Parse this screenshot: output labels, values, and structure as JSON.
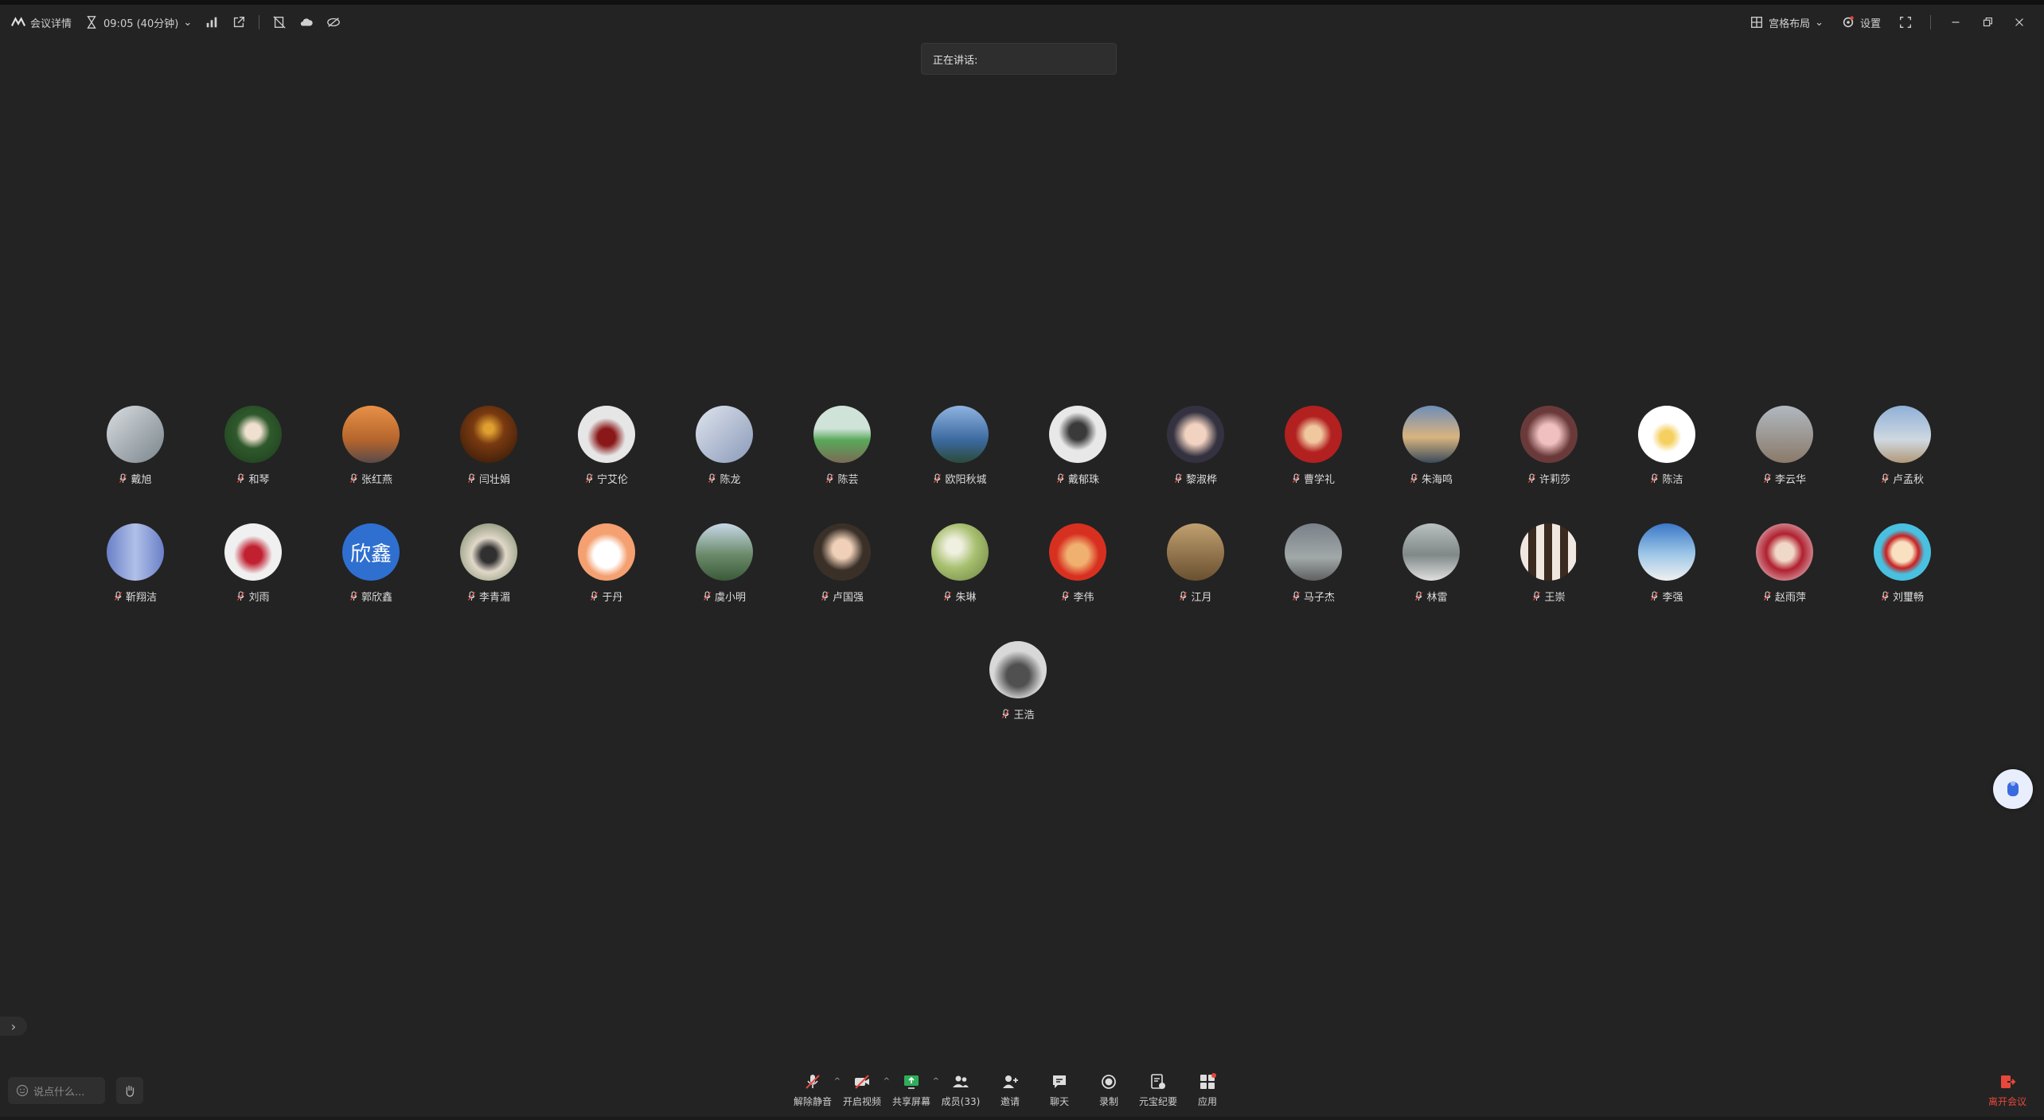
{
  "titlebar": {
    "details_label": "会议详情",
    "timer": "09:05 (40分钟)",
    "layout_label": "宫格布局",
    "settings_label": "设置"
  },
  "speaking_label": "正在讲话:",
  "participants": [
    {
      "name": "戴旭",
      "bg": "linear-gradient(135deg,#d9dde0,#7a858c)"
    },
    {
      "name": "和琴",
      "bg": "radial-gradient(circle at 50% 45%,#f0e0d0 18%,#2f5a2c 40%,#1d3b1b)"
    },
    {
      "name": "张红燕",
      "bg": "linear-gradient(180deg,#e89048,#b5652c 60%,#5a4a4a)"
    },
    {
      "name": "闫壮娟",
      "bg": "radial-gradient(circle at 50% 40%,#e0a030 10%,#7a3a10 35%,#2a1508)"
    },
    {
      "name": "宁艾伦",
      "bg": "radial-gradient(circle at 50% 55%,#8a1818 20%,#e6e6e6 45%)"
    },
    {
      "name": "陈龙",
      "bg": "linear-gradient(135deg,#dfe4ee,#8a9ab8)"
    },
    {
      "name": "陈芸",
      "bg": "linear-gradient(180deg,#cfe3d9 40%,#59a85a 60%,#7a6a55)"
    },
    {
      "name": "欧阳秋城",
      "bg": "linear-gradient(180deg,#8fb3e0,#3c6aa0 60%,#2b4a3a)"
    },
    {
      "name": "戴郁珠",
      "bg": "radial-gradient(circle at 50% 45%,#3a3a3a 20%,#e8e8e8 45%)"
    },
    {
      "name": "黎淑桦",
      "bg": "radial-gradient(circle at 50% 50%,#f2d2c0 25%,#343240 55%)"
    },
    {
      "name": "曹学礼",
      "bg": "radial-gradient(circle at 50% 50%,#f0c8a0 20%,#b22020 45%)"
    },
    {
      "name": "朱海鸣",
      "bg": "linear-gradient(180deg,#6e8db8,#d9b480 55%,#3a4a5a)"
    },
    {
      "name": "许莉莎",
      "bg": "radial-gradient(circle at 50% 50%,#f0c0c0 25%,#6a3a3a 55%)"
    },
    {
      "name": "陈洁",
      "bg": "radial-gradient(circle at 50% 55%,#f5d060 15%,#ffffff 35%)"
    },
    {
      "name": "李云华",
      "bg": "linear-gradient(180deg,#b0b8c0,#8a7a6a)"
    },
    {
      "name": "卢孟秋",
      "bg": "linear-gradient(180deg,#8fb0d8,#cfd8e0 60%,#b09878)"
    },
    {
      "name": "靳翔洁",
      "bg": "linear-gradient(90deg,#6a80c8,#b0c0e8,#6a80c8)"
    },
    {
      "name": "刘雨",
      "bg": "radial-gradient(circle at 50% 55%,#c02030 20%,#f0f0f0 45%)"
    },
    {
      "name": "郭欣鑫",
      "bg": "#2f6fd0",
      "text": "欣鑫"
    },
    {
      "name": "李青湄",
      "bg": "radial-gradient(circle at 50% 55%,#303030 18%,#e0d8c8 40%,#6a7a5a)"
    },
    {
      "name": "于丹",
      "bg": "radial-gradient(circle at 50% 55%,#ffffff 30%,#f4a070 50%)"
    },
    {
      "name": "虞小明",
      "bg": "linear-gradient(180deg,#c8d8e8,#6a8a6a 55%,#3a5a3a)"
    },
    {
      "name": "卢国强",
      "bg": "radial-gradient(circle at 50% 45%,#f0d0b8 22%,#3a3028 50%)"
    },
    {
      "name": "朱琳",
      "bg": "radial-gradient(circle at 40% 40%,#f0f0e0 15%,#a8c070 45%,#6a8040)"
    },
    {
      "name": "李伟",
      "bg": "radial-gradient(circle at 50% 55%,#f0b070 25%,#d83020 50%)"
    },
    {
      "name": "江月",
      "bg": "linear-gradient(180deg,#c0a070,#6a5030)"
    },
    {
      "name": "马子杰",
      "bg": "linear-gradient(180deg,#7a8088,#a0a8a8 60%,#606060)"
    },
    {
      "name": "林雷",
      "bg": "linear-gradient(180deg,#b8c0c0,#808888 55%,#e0e0e0)"
    },
    {
      "name": "王崇",
      "bg": "repeating-linear-gradient(90deg,#f0e8e0 0 10px,#3a2a20 10px 20px)"
    },
    {
      "name": "李强",
      "bg": "linear-gradient(180deg,#3a78c8,#a0c8e8 55%,#f0f0f0)"
    },
    {
      "name": "赵雨萍",
      "bg": "radial-gradient(circle at 50% 50%,#f0d8c8 22%,#b02030 45%,#f0e8e8)"
    },
    {
      "name": "刘璽畅",
      "bg": "radial-gradient(circle at 50% 50%,#f8e0c0 25%,#c82020 40%,#4ac0e0 55%)"
    },
    {
      "name": "王浩",
      "bg": "radial-gradient(circle at 50% 60%,#505050 25%,#d8d8d8 55%)"
    }
  ],
  "side_toggle": "›",
  "bottom": {
    "chat_placeholder": "说点什么...",
    "tools": [
      {
        "label": "解除静音",
        "icon": "mic-off-icon",
        "caret": true
      },
      {
        "label": "开启视频",
        "icon": "video-off-icon",
        "caret": true
      },
      {
        "label": "共享屏幕",
        "icon": "share-screen-icon",
        "caret": true
      },
      {
        "label": "成员(33)",
        "icon": "members-icon",
        "caret": false
      },
      {
        "label": "邀请",
        "icon": "invite-icon",
        "caret": false
      },
      {
        "label": "聊天",
        "icon": "chat-icon",
        "caret": false
      },
      {
        "label": "录制",
        "icon": "record-icon",
        "caret": false
      },
      {
        "label": "元宝纪要",
        "icon": "notes-icon",
        "caret": false
      },
      {
        "label": "应用",
        "icon": "apps-icon",
        "caret": false
      }
    ],
    "leave_label": "离开会议"
  },
  "colors": {
    "background": "#232323",
    "leave": "#e8473c",
    "accent": "#2f6fd0"
  }
}
